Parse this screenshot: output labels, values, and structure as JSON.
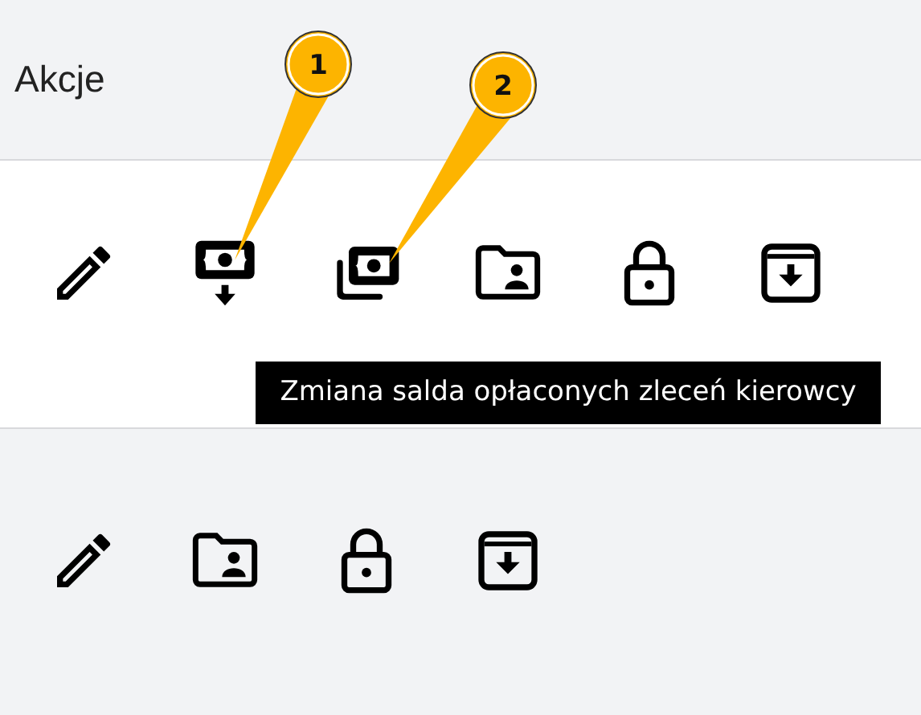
{
  "header": {
    "title": "Akcje"
  },
  "rows": [
    {
      "actions": [
        {
          "kind": "edit"
        },
        {
          "kind": "cash-down"
        },
        {
          "kind": "cash-stack"
        },
        {
          "kind": "folder-user"
        },
        {
          "kind": "lock"
        },
        {
          "kind": "archive"
        }
      ]
    },
    {
      "actions": [
        {
          "kind": "edit"
        },
        {
          "kind": "folder-user"
        },
        {
          "kind": "lock"
        },
        {
          "kind": "archive"
        }
      ]
    }
  ],
  "tooltip": {
    "text": "Zmiana salda opłaconych zleceń kierowcy"
  },
  "callouts": [
    {
      "label": "1"
    },
    {
      "label": "2"
    }
  ]
}
